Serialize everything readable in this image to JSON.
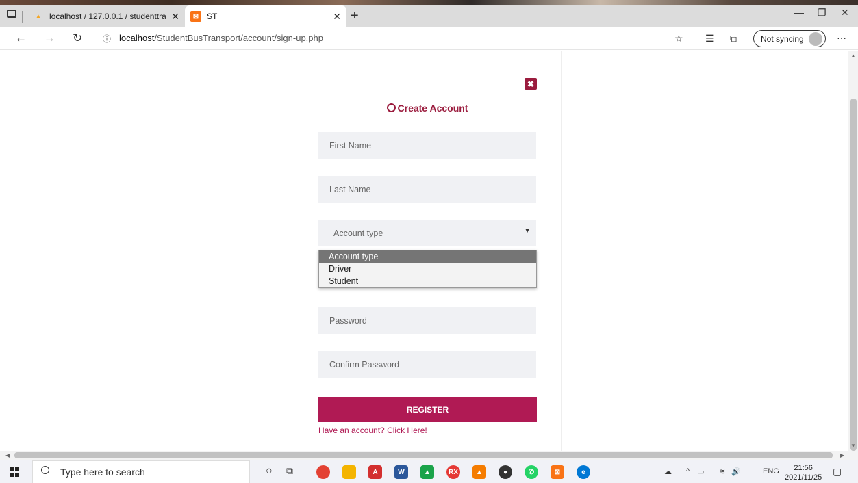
{
  "browser": {
    "tabs": [
      {
        "label": "localhost / 127.0.0.1 / studenttra",
        "favicon": "pma-icon",
        "active": false
      },
      {
        "label": "ST",
        "favicon": "st-icon",
        "active": true
      }
    ],
    "url_host": "localhost",
    "url_path": "/StudentBusTransport/account/sign-up.php",
    "sync_label": "Not syncing"
  },
  "form": {
    "heading": "Create Account",
    "close_label": "✖",
    "first_name_placeholder": "First Name",
    "last_name_placeholder": "Last Name",
    "account_type_value": "Account type",
    "account_type_options": [
      "Account type",
      "Driver",
      "Student"
    ],
    "password_placeholder": "Password",
    "confirm_password_placeholder": "Confirm Password",
    "register_label": "REGISTER",
    "login_link": "Have an account? Click Here!"
  },
  "taskbar": {
    "search_placeholder": "Type here to search",
    "lang": "ENG",
    "time": "21:56",
    "date": "2021/11/25"
  },
  "colors": {
    "accent": "#b01a54",
    "close_button": "#9b1c3e",
    "field_bg": "#f0f1f4"
  }
}
